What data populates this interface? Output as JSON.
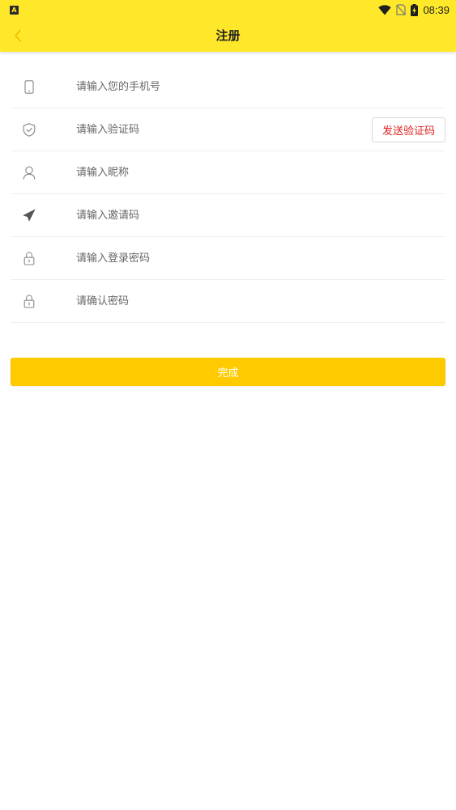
{
  "status_bar": {
    "time": "08:39",
    "app_icon_letter": "A"
  },
  "header": {
    "title": "注册",
    "back_icon": "chevron-left-icon"
  },
  "form": {
    "phone": {
      "icon": "phone-icon",
      "placeholder": "请输入您的手机号",
      "value": ""
    },
    "code": {
      "icon": "shield-icon",
      "placeholder": "请输入验证码",
      "value": "",
      "send_label": "发送验证码"
    },
    "nickname": {
      "icon": "user-icon",
      "placeholder": "请输入昵称",
      "value": ""
    },
    "invite": {
      "icon": "send-icon",
      "placeholder": "请输入邀请码",
      "value": ""
    },
    "password": {
      "icon": "lock-icon",
      "placeholder": "请输入登录密码",
      "value": ""
    },
    "confirm_password": {
      "icon": "lock-icon",
      "placeholder": "请确认密码",
      "value": ""
    }
  },
  "submit_label": "完成",
  "colors": {
    "header_bg": "#ffe82a",
    "button_bg": "#ffcb00",
    "send_code_text": "#e02020"
  }
}
